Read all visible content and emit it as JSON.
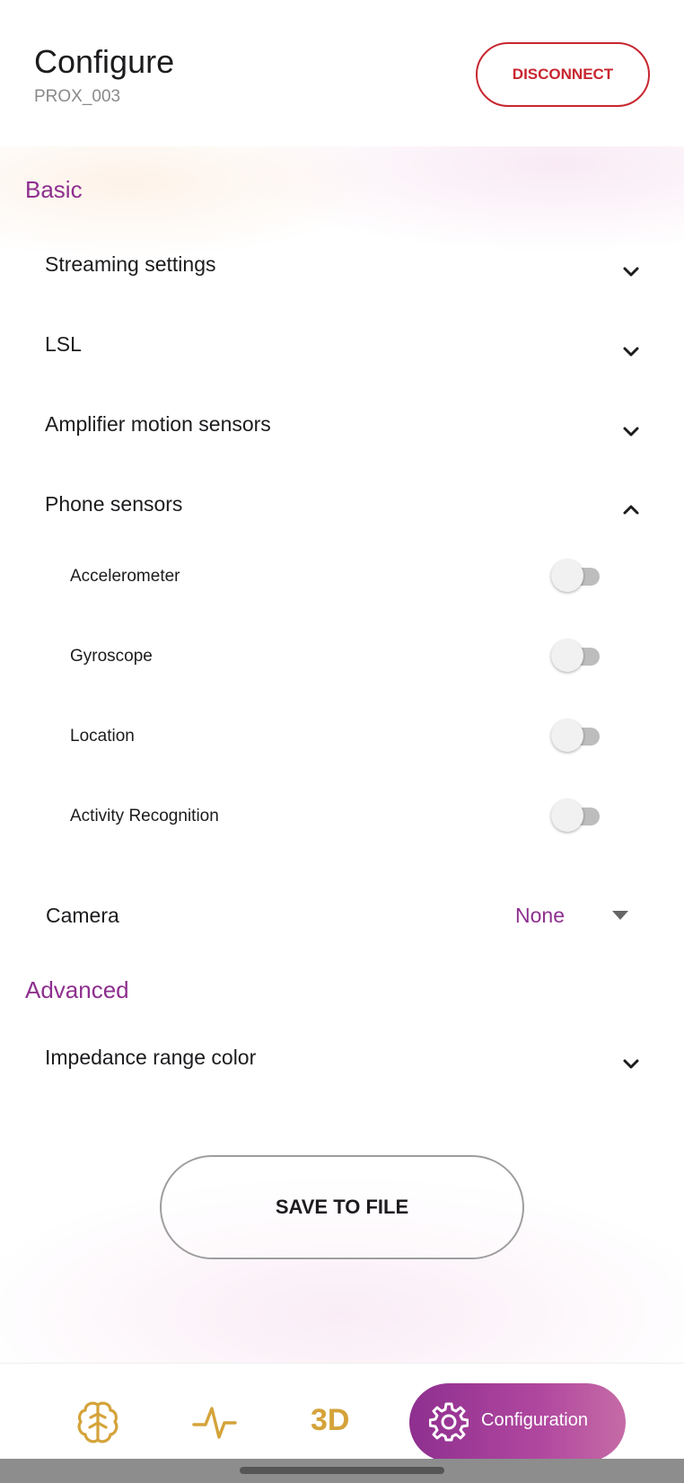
{
  "header": {
    "title": "Configure",
    "device": "PROX_003",
    "disconnect_label": "DISCONNECT"
  },
  "basic": {
    "section_title": "Basic",
    "rows": {
      "streaming": {
        "label": "Streaming settings",
        "expanded": false
      },
      "lsl": {
        "label": "LSL",
        "expanded": false
      },
      "amplifier": {
        "label": "Amplifier motion sensors",
        "expanded": false
      },
      "phone": {
        "label": "Phone sensors",
        "expanded": true
      }
    },
    "phone_sensors": {
      "accelerometer": {
        "label": "Accelerometer",
        "enabled": false
      },
      "gyroscope": {
        "label": "Gyroscope",
        "enabled": false
      },
      "location": {
        "label": "Location",
        "enabled": false
      },
      "activity": {
        "label": "Activity Recognition",
        "enabled": false
      }
    },
    "camera": {
      "label": "Camera",
      "value": "None"
    }
  },
  "advanced": {
    "section_title": "Advanced",
    "impedance": {
      "label": "Impedance range color",
      "expanded": false
    }
  },
  "save_label": "SAVE TO FILE",
  "nav": {
    "items": [
      "brain-icon",
      "signal-icon",
      "3D",
      "gear-icon"
    ],
    "three_d_label": "3D",
    "active_label": "Configuration"
  },
  "colors": {
    "accent": "#8e2f8f",
    "danger": "#c8262f",
    "nav_icon": "#d4a33a"
  }
}
